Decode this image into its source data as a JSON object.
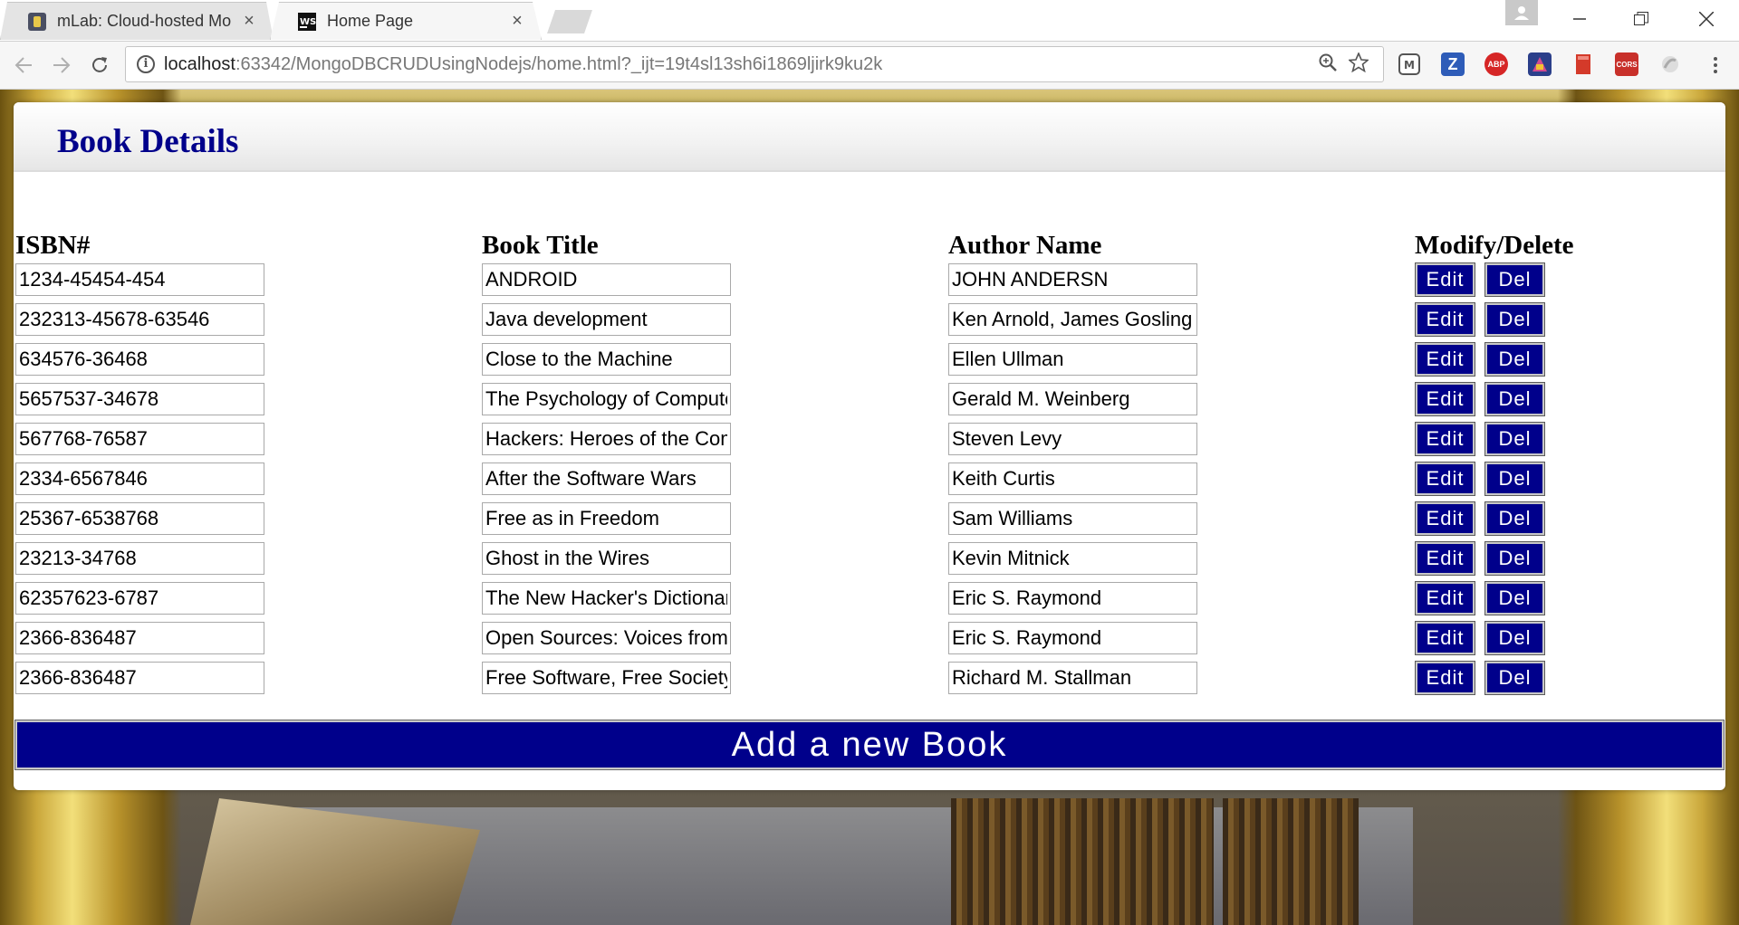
{
  "browser": {
    "tabs": [
      {
        "title": "mLab: Cloud-hosted Mo",
        "active": false
      },
      {
        "title": "Home Page",
        "active": true
      }
    ],
    "close_glyph": "×",
    "url_host": "localhost",
    "url_rest": ":63342/MongoDBCRUDUsingNodejs/home.html?_ijt=19t4sl13sh6i1869ljirk9ku2k",
    "extensions": [
      {
        "name": "mlab-extension-icon",
        "label": "M",
        "color": "#555555"
      },
      {
        "name": "zotero-icon",
        "label": "Z",
        "color": "#2e5cb8"
      },
      {
        "name": "adblock-plus-icon",
        "label": "ABP",
        "color": "#d62626"
      },
      {
        "name": "extension-blue-icon",
        "label": "",
        "color": "#2b3f8a"
      },
      {
        "name": "bookmark-red-icon",
        "label": "",
        "color": "#d43a2a"
      },
      {
        "name": "cors-icon",
        "label": "CORS",
        "color": "#c8302a"
      },
      {
        "name": "extension-grey-icon",
        "label": "",
        "color": "#cccccc"
      }
    ]
  },
  "page": {
    "title": "Book Details",
    "columns": {
      "isbn": "ISBN#",
      "title": "Book Title",
      "author": "Author Name",
      "actions": "Modify/Delete"
    },
    "edit_label": "Edit",
    "del_label": "Del",
    "add_label": "Add a new Book",
    "books": [
      {
        "isbn": "1234-45454-454",
        "title": "ANDROID",
        "author": "JOHN ANDERSN"
      },
      {
        "isbn": "232313-45678-63546",
        "title": "Java development",
        "author": "Ken Arnold, James Gosling"
      },
      {
        "isbn": "634576-36468",
        "title": "Close to the Machine",
        "author": "Ellen Ullman"
      },
      {
        "isbn": "5657537-34678",
        "title": "The Psychology of Computer Programming",
        "author": "Gerald M. Weinberg"
      },
      {
        "isbn": "567768-76587",
        "title": "Hackers: Heroes of the Computer Revolution",
        "author": "Steven Levy"
      },
      {
        "isbn": "2334-6567846",
        "title": "After the Software Wars",
        "author": "Keith Curtis"
      },
      {
        "isbn": "25367-6538768",
        "title": "Free as in Freedom",
        "author": "Sam Williams"
      },
      {
        "isbn": "23213-34768",
        "title": "Ghost in the Wires",
        "author": "Kevin Mitnick"
      },
      {
        "isbn": "62357623-6787",
        "title": "The New Hacker's Dictionary",
        "author": "Eric S. Raymond"
      },
      {
        "isbn": "2366-836487",
        "title": "Open Sources: Voices from the Open Source Revolution",
        "author": "Eric S. Raymond"
      },
      {
        "isbn": "2366-836487",
        "title": "Free Software, Free Society",
        "author": "Richard M. Stallman"
      }
    ]
  },
  "colors": {
    "accent": "#00008b",
    "title": "#00008b"
  }
}
